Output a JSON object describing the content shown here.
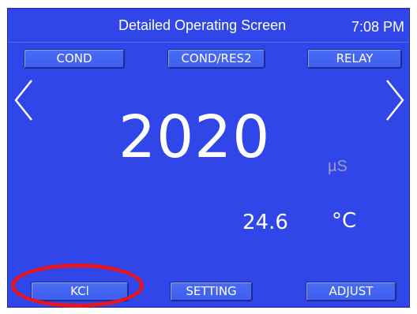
{
  "header": {
    "title": "Detailed Operating Screen",
    "time": "7:08 PM"
  },
  "top_tabs": {
    "cond": "COND",
    "cond_res2": "COND/RES2",
    "relay": "RELAY"
  },
  "nav": {
    "prev_icon": "chevron-left-icon",
    "next_icon": "chevron-right-icon"
  },
  "reading": {
    "value": "2020",
    "unit": "µS"
  },
  "temperature": {
    "value": "24.6",
    "unit": "°C"
  },
  "bottom_buttons": {
    "kcl": "KCl",
    "setting": "SETTING",
    "adjust": "ADJUST"
  },
  "colors": {
    "screen_bg": "#3046e8",
    "button_bg": "#4566f2",
    "highlight": "#e8141e",
    "unit_text": "#9a9cc6"
  }
}
